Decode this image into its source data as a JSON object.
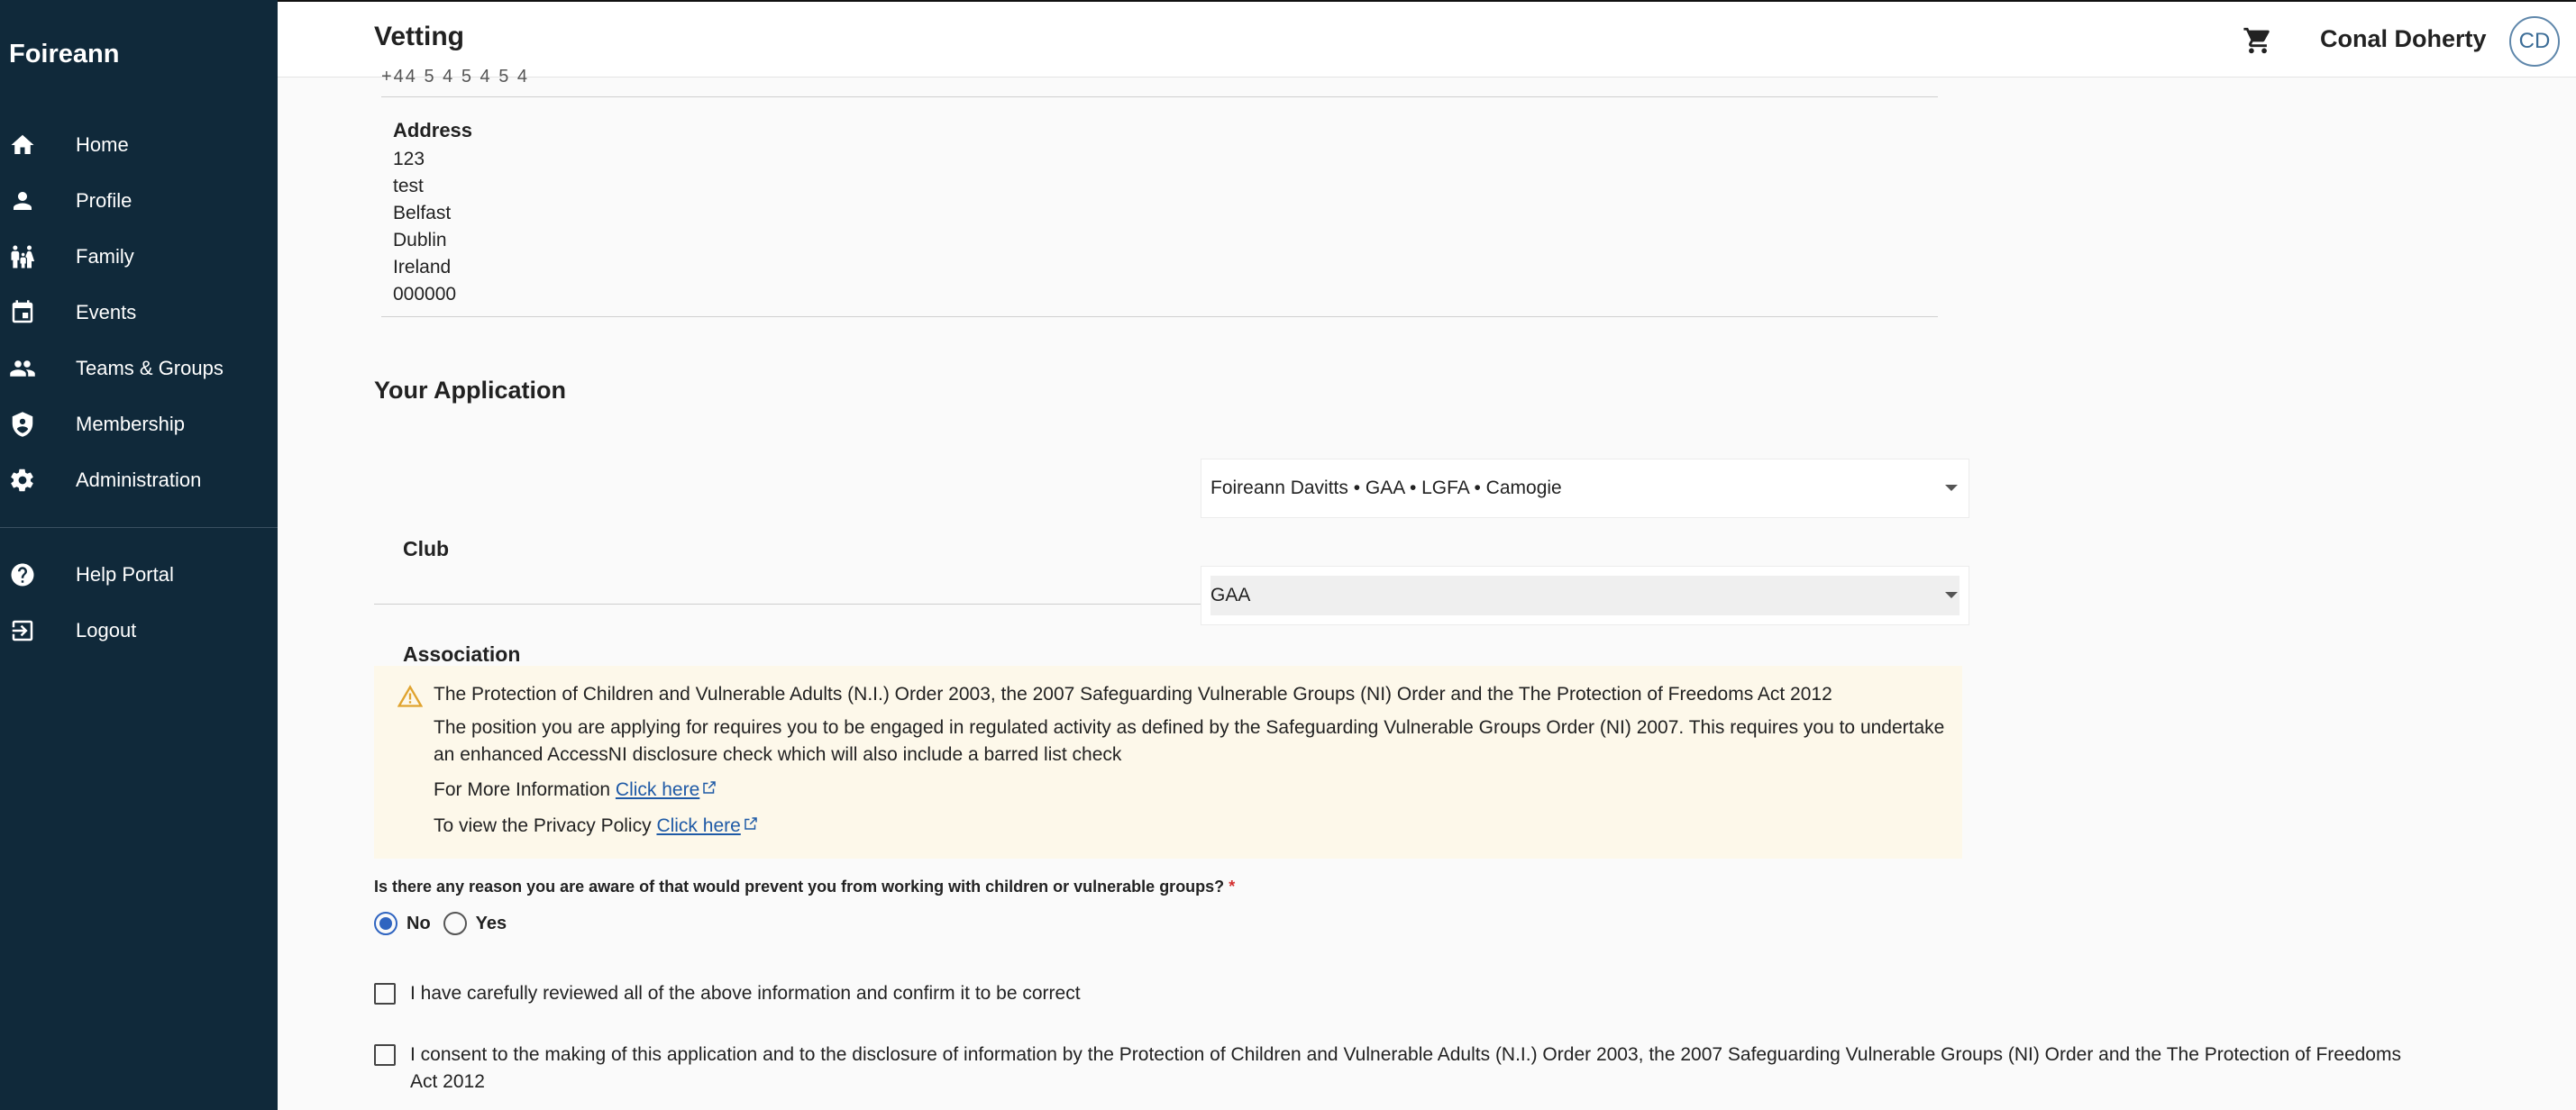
{
  "sidebar": {
    "brand": "Foireann",
    "items": [
      {
        "label": "Home",
        "icon": "home-icon"
      },
      {
        "label": "Profile",
        "icon": "person-icon"
      },
      {
        "label": "Family",
        "icon": "family-icon"
      },
      {
        "label": "Events",
        "icon": "calendar-icon"
      },
      {
        "label": "Teams & Groups",
        "icon": "group-icon"
      },
      {
        "label": "Membership",
        "icon": "shield-icon"
      },
      {
        "label": "Administration",
        "icon": "gear-icon"
      }
    ],
    "bottom_items": [
      {
        "label": "Help Portal",
        "icon": "help-icon"
      },
      {
        "label": "Logout",
        "icon": "logout-icon"
      }
    ]
  },
  "header": {
    "title": "Vetting",
    "user_name": "Conal Doherty",
    "avatar_initials": "CD"
  },
  "details": {
    "clipped_value": "+44 5 4 5 4 5 4",
    "address_label": "Address",
    "address_lines": [
      "123",
      "test",
      "Belfast",
      "Dublin",
      "Ireland",
      "000000"
    ]
  },
  "application": {
    "section_title": "Your Application",
    "club_label": "Club",
    "club_value": "Foireann Davitts • GAA • LGFA • Camogie",
    "association_label": "Association",
    "association_value": "GAA"
  },
  "notice": {
    "title": "The Protection of Children and Vulnerable Adults (N.I.) Order 2003, the 2007 Safeguarding Vulnerable Groups (NI) Order and the The Protection of Freedoms Act 2012",
    "body": "The position you are applying for requires you to be engaged in regulated activity as defined by the Safeguarding Vulnerable Groups Order (NI) 2007. This requires you to undertake an enhanced AccessNI disclosure check which will also include a barred list check",
    "more_info_prefix": "For More Information",
    "more_info_link": "Click here",
    "privacy_prefix": "To view the Privacy Policy",
    "privacy_link": "Click here"
  },
  "question": {
    "text": "Is there any reason you are aware of that would prevent you from working with children or vulnerable groups?",
    "required_mark": "*",
    "options": [
      "No",
      "Yes"
    ],
    "selected": "No"
  },
  "checkboxes": {
    "confirm": "I have carefully reviewed all of the above information and confirm it to be correct",
    "consent": "I consent to the making of this application and to the disclosure of information by the Protection of Children and Vulnerable Adults (N.I.) Order 2003, the 2007 Safeguarding Vulnerable Groups (NI) Order and the The Protection of Freedoms Act 2012"
  },
  "colors": {
    "sidebar_bg": "#10293a",
    "notice_bg": "#fdf8ea",
    "link": "#1f5aa6",
    "radio_selected": "#2f64c0",
    "required": "#d32f2f"
  }
}
